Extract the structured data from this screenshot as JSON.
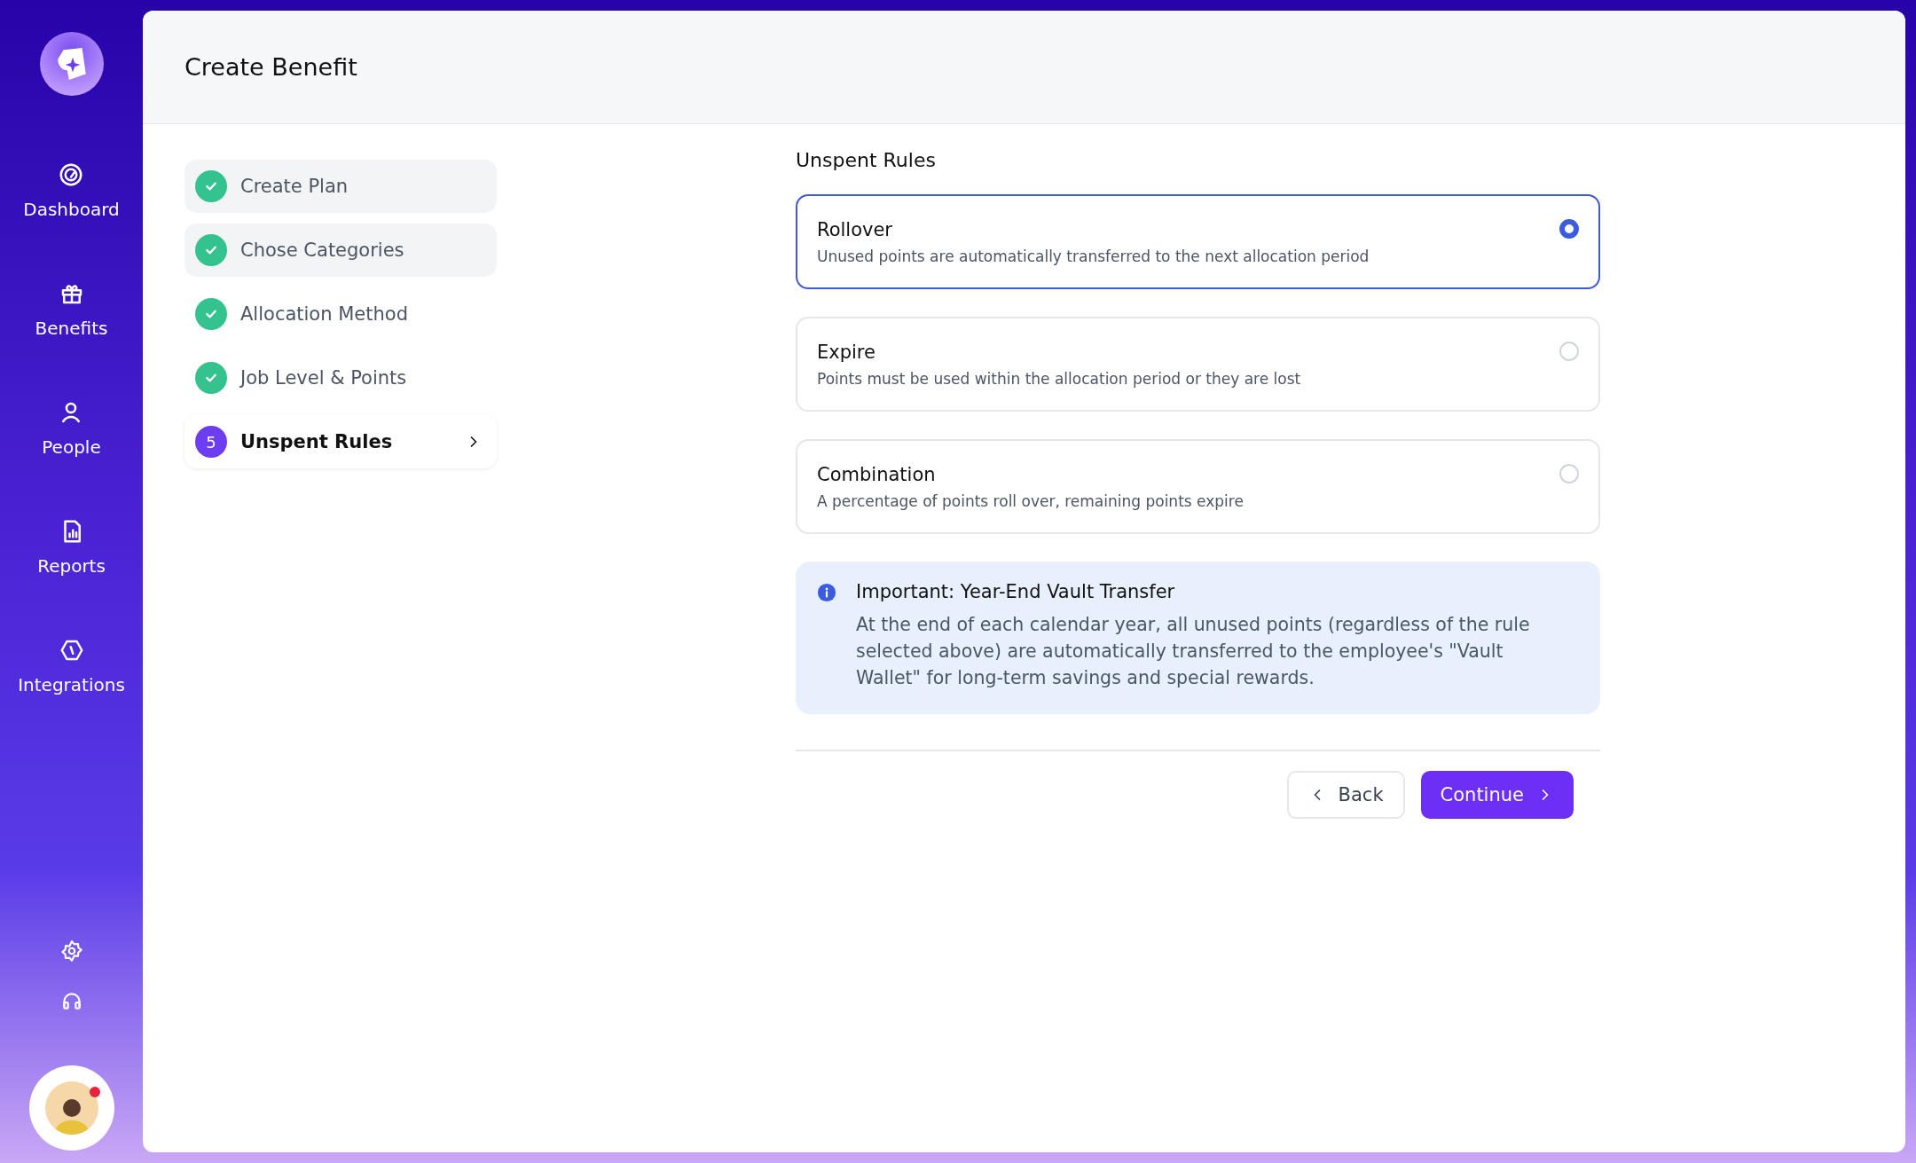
{
  "sidebar": {
    "items": [
      {
        "label": "Dashboard",
        "selected": false
      },
      {
        "label": "Benefits",
        "selected": false
      },
      {
        "label": "People",
        "selected": false
      },
      {
        "label": "Reports",
        "selected": false
      },
      {
        "label": "Integrations",
        "selected": false
      }
    ],
    "user": {
      "notification": true
    }
  },
  "header": {
    "title": "Create Benefit"
  },
  "steps": [
    {
      "label": "Create Plan",
      "completed": true,
      "selected": false,
      "shaded": true
    },
    {
      "label": "Chose Categories",
      "completed": true,
      "selected": false,
      "shaded": true
    },
    {
      "label": "Allocation Method",
      "completed": true,
      "selected": false,
      "shaded": false
    },
    {
      "label": "Job Level & Points",
      "completed": true,
      "selected": false,
      "shaded": false
    },
    {
      "label": "Unspent Rules",
      "number": "5",
      "completed": false,
      "selected": true,
      "shaded": false
    }
  ],
  "section": {
    "title": "Unspent Rules"
  },
  "options": [
    {
      "title": "Rollover",
      "description": "Unused points are automatically transferred to the next allocation period",
      "selected": true
    },
    {
      "title": "Expire",
      "description": "Points must be used within the allocation period or they are lost",
      "selected": false
    },
    {
      "title": "Combination",
      "description": "A percentage of points roll over, remaining points expire",
      "selected": false
    }
  ],
  "notice": {
    "title": "Important: Year-End Vault Transfer",
    "text": "At the end of each calendar year, all unused points (regardless of the rule selected above) are automatically transferred to the employee's \"Vault Wallet\" for long-term savings and special rewards."
  },
  "buttons": [
    {
      "kind": "secondary",
      "label": "Back"
    },
    {
      "kind": "primary",
      "label": "Continue"
    }
  ]
}
